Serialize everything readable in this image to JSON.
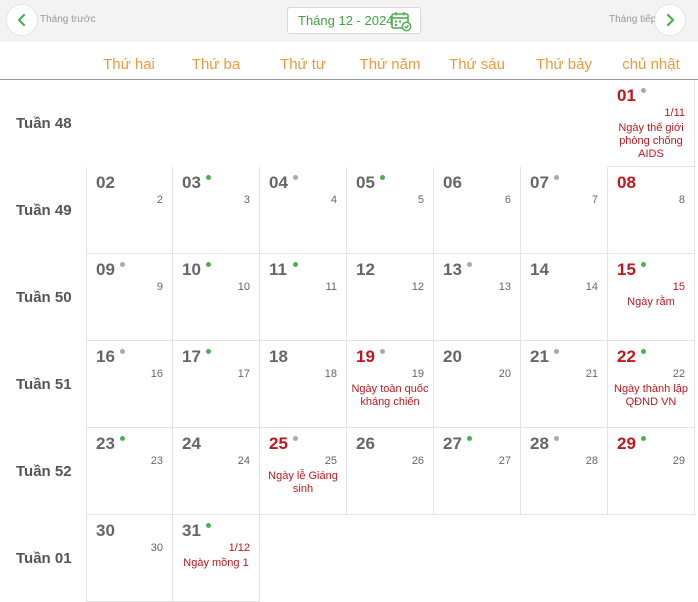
{
  "nav": {
    "prev_label": "Tháng trước",
    "next_label": "Tháng tiếp",
    "month_label": "Tháng 12 - 2024"
  },
  "colors": {
    "accent_green": "#3ea541",
    "weekday_orange": "#f0983a",
    "holiday_red": "#c2161c"
  },
  "weekdays": [
    "Thứ hai",
    "Thứ ba",
    "Thứ tư",
    "Thứ năm",
    "Thứ sáu",
    "Thứ bảy",
    "chủ nhật"
  ],
  "weeks": [
    {
      "label": "Tuần 48",
      "days": [
        null,
        null,
        null,
        null,
        null,
        null,
        {
          "solar": "01",
          "lunar": "1/11",
          "dot": "gray",
          "red": true,
          "lunar_red": true,
          "event": "Ngày thế giới phòng chống AIDS"
        }
      ]
    },
    {
      "label": "Tuần 49",
      "days": [
        {
          "solar": "02",
          "lunar": "2"
        },
        {
          "solar": "03",
          "lunar": "3",
          "dot": "green"
        },
        {
          "solar": "04",
          "lunar": "4",
          "dot": "gray"
        },
        {
          "solar": "05",
          "lunar": "5",
          "dot": "green"
        },
        {
          "solar": "06",
          "lunar": "6"
        },
        {
          "solar": "07",
          "lunar": "7",
          "dot": "gray"
        },
        {
          "solar": "08",
          "lunar": "8",
          "red": true
        }
      ]
    },
    {
      "label": "Tuần 50",
      "days": [
        {
          "solar": "09",
          "lunar": "9",
          "dot": "gray"
        },
        {
          "solar": "10",
          "lunar": "10",
          "dot": "green"
        },
        {
          "solar": "11",
          "lunar": "11",
          "dot": "green"
        },
        {
          "solar": "12",
          "lunar": "12"
        },
        {
          "solar": "13",
          "lunar": "13",
          "dot": "gray"
        },
        {
          "solar": "14",
          "lunar": "14"
        },
        {
          "solar": "15",
          "lunar": "15",
          "dot": "green",
          "red": true,
          "lunar_red": true,
          "event": "Ngày rằm"
        }
      ]
    },
    {
      "label": "Tuần 51",
      "days": [
        {
          "solar": "16",
          "lunar": "16",
          "dot": "gray"
        },
        {
          "solar": "17",
          "lunar": "17",
          "dot": "green"
        },
        {
          "solar": "18",
          "lunar": "18"
        },
        {
          "solar": "19",
          "lunar": "19",
          "dot": "gray",
          "red": true,
          "event": "Ngày toàn quốc kháng chiến"
        },
        {
          "solar": "20",
          "lunar": "20"
        },
        {
          "solar": "21",
          "lunar": "21",
          "dot": "gray"
        },
        {
          "solar": "22",
          "lunar": "22",
          "dot": "green",
          "red": true,
          "event": "Ngày thành lập QĐND VN"
        }
      ]
    },
    {
      "label": "Tuần 52",
      "days": [
        {
          "solar": "23",
          "lunar": "23",
          "dot": "green"
        },
        {
          "solar": "24",
          "lunar": "24"
        },
        {
          "solar": "25",
          "lunar": "25",
          "dot": "gray",
          "red": true,
          "event": "Ngày lễ Giáng sinh"
        },
        {
          "solar": "26",
          "lunar": "26"
        },
        {
          "solar": "27",
          "lunar": "27",
          "dot": "green"
        },
        {
          "solar": "28",
          "lunar": "28",
          "dot": "gray"
        },
        {
          "solar": "29",
          "lunar": "29",
          "dot": "green",
          "red": true
        }
      ]
    },
    {
      "label": "Tuần 01",
      "days": [
        {
          "solar": "30",
          "lunar": "30"
        },
        {
          "solar": "31",
          "lunar": "1/12",
          "dot": "green",
          "lunar_red": true,
          "event": "Ngày mồng 1"
        },
        null,
        null,
        null,
        null,
        null
      ]
    }
  ]
}
